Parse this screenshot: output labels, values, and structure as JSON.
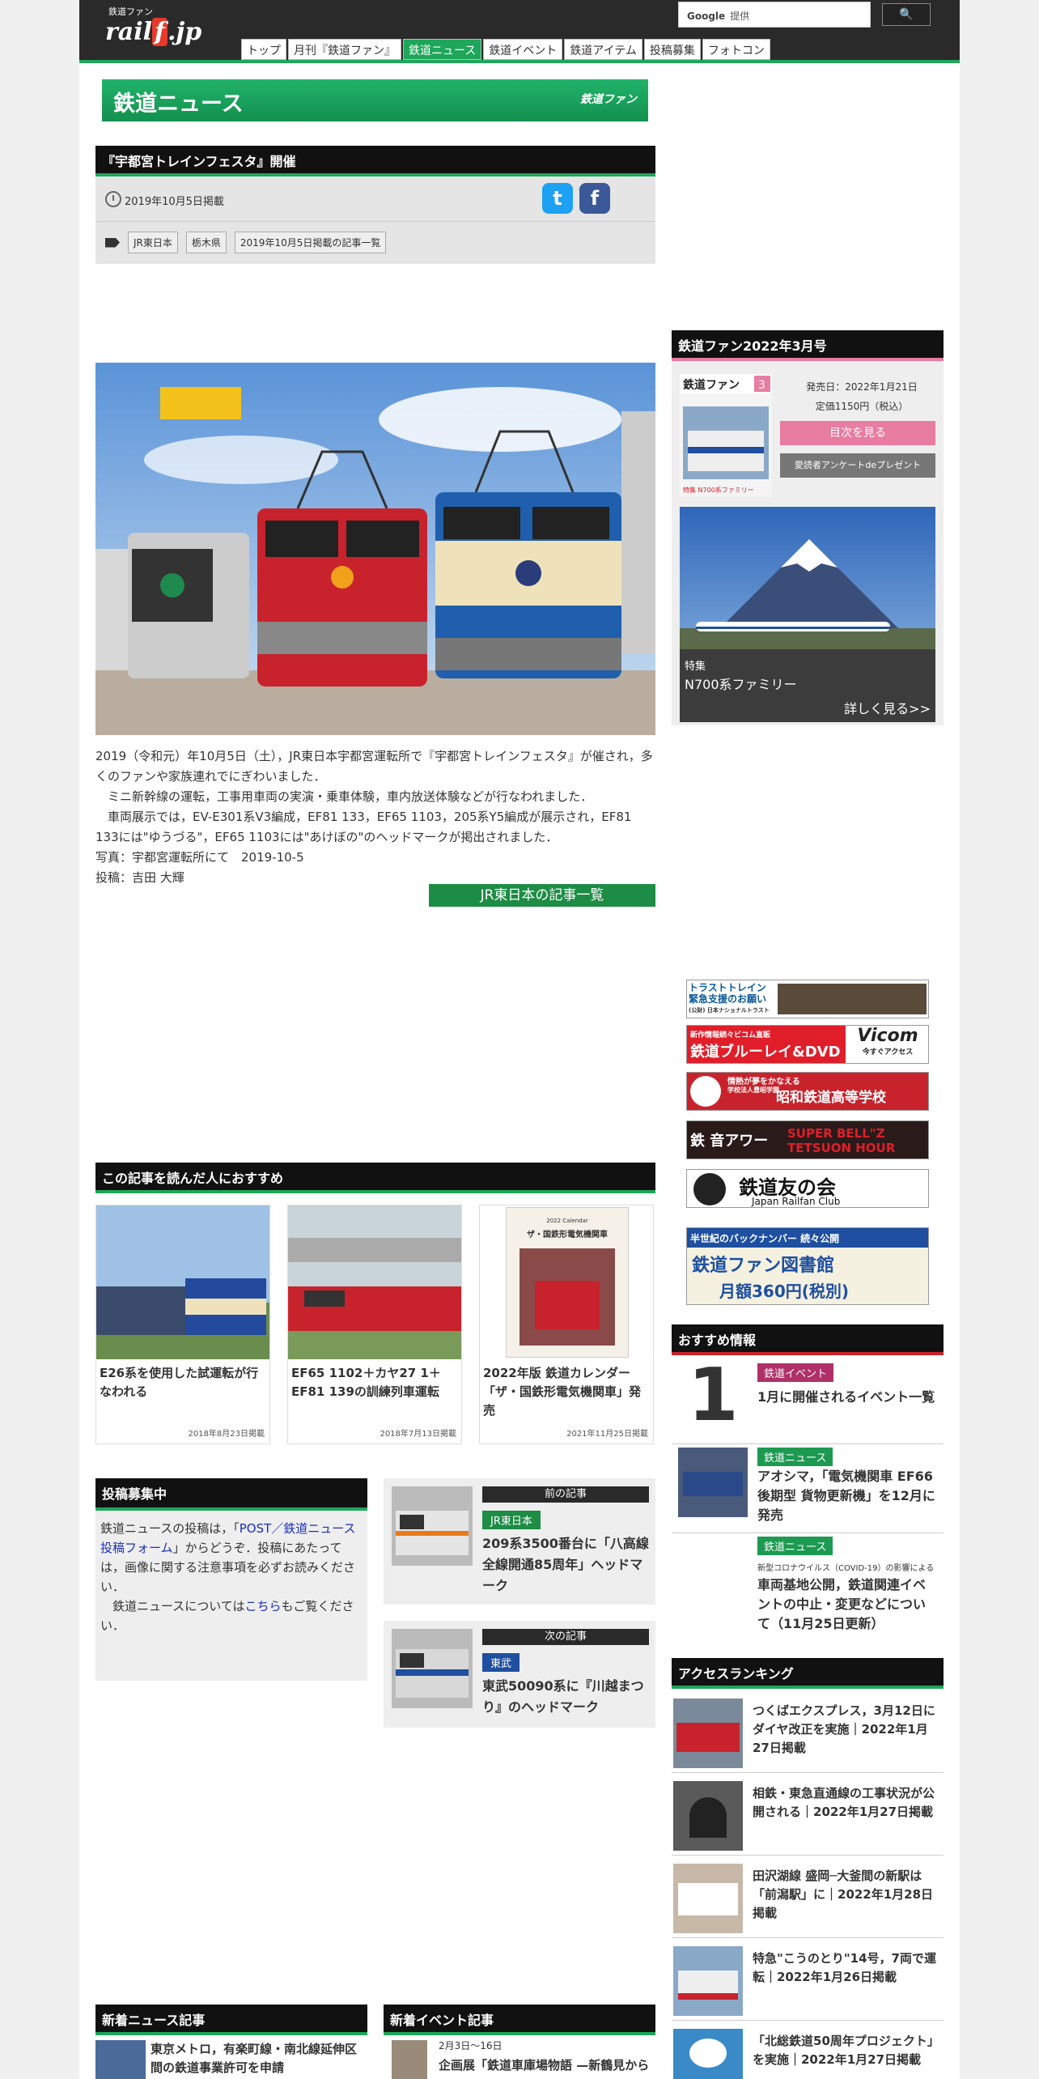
{
  "header": {
    "logo_small": "鉄道ファン",
    "logo_text": "railf.jp",
    "search_brand": "Google",
    "search_suffix": "提供",
    "search_btn": "🔍"
  },
  "nav": [
    "トップ",
    "月刊『鉄道ファン』",
    "鉄道ニュース",
    "鉄道イベント",
    "鉄道アイテム",
    "投稿募集",
    "フォトコン"
  ],
  "banner": {
    "title": "鉄道ニュース",
    "sub": "鉄道ファン"
  },
  "article": {
    "title": "『宇都宮トレインフェスタ』開催",
    "date": "2019年10月5日掲載",
    "tags": [
      "JR東日本",
      "栃木県",
      "2019年10月5日掲載の記事一覧"
    ],
    "body": [
      "2019（令和元）年10月5日（土），JR東日本宇都宮運転所で『宇都宮トレインフェスタ』が催され，多くのファンや家族連れでにぎわいました．",
      "　ミニ新幹線の運転，工事用車両の実演・乗車体験，車内放送体験などが行なわれました．",
      "　車両展示では，EV-E301系V3編成，EF81 133，EF65 1103，205系Y5編成が展示され，EF81 133には\"ゆうづる\"，EF65 1103には\"あけぼの\"のヘッドマークが掲出されました．",
      "写真：宇都宮運転所にて　2019-10-5",
      "投稿：吉田 大輝"
    ],
    "more_btn": "JR東日本の記事一覧"
  },
  "recommend": {
    "heading": "この記事を読んだ人におすすめ",
    "items": [
      {
        "caption": "E26系を使用した試運転が行なわれる",
        "date": "2018年8月23日掲載"
      },
      {
        "caption": "EF65 1102＋カヤ27 1＋EF81 139の訓練列車運転",
        "date": "2018年7月13日掲載"
      },
      {
        "caption": "2022年版 鉄道カレンダー「ザ・国鉄形電気機関車」発売",
        "date": "2021年11月25日掲載",
        "calendar_title": "2022 Calendar",
        "calendar_name": "ザ・国鉄形電気機関車"
      }
    ]
  },
  "post": {
    "heading": "投稿募集中",
    "text1": "鉄道ニュースの投稿は，「",
    "link1": "POST／鉄道ニュース投稿フォーム",
    "text2": "」からどうぞ．投稿にあたっては，画像に関する注意事項を必ずお読みください．",
    "text3": "　鉄道ニュースについては",
    "link2": "こちら",
    "text4": "もご覧ください．"
  },
  "prev": {
    "label": "前の記事",
    "category": "JR東日本",
    "title": "209系3500番台に「八高線全線開通85周年」ヘッドマーク"
  },
  "next": {
    "label": "次の記事",
    "category": "東武",
    "title": "東武50090系に『川越まつり』のヘッドマーク"
  },
  "magazine": {
    "heading": "鉄道ファン2022年3月号",
    "cover_title": "鉄道ファン",
    "cover_issue": "3",
    "cover_feature": "特集 N700系ファミリー",
    "release": "発売日：2022年1月21日",
    "price": "定価1150円（税込）",
    "btn_toc": "目次を見る",
    "btn_survey": "愛読者アンケートdeプレゼント",
    "feature_label": "特集",
    "feature_title": "N700系ファミリー",
    "feature_more": "詳しく見る>>"
  },
  "ads": [
    {
      "line1": "トラストトレイン",
      "line2": "緊急支援のお願い",
      "line3": "(公財) 日本ナショナルトラスト"
    },
    {
      "line1": "新作情報続々ビコム直販",
      "line2": "鉄道ブルーレイ&DVD",
      "brand": "Vicom",
      "sub": "今すぐアクセス"
    },
    {
      "line1": "情熱が夢をかなえる",
      "line2": "昭和鉄道高等学校",
      "sub": "学校法人豊昭学園"
    },
    {
      "line1": "鉄 音アワー",
      "line2": "SUPER BELL\"Z TETSUON HOUR"
    },
    {
      "line1": "鉄道友の会",
      "line2": "Japan Railfan Club"
    },
    {
      "line1": "半世紀のバックナンバー 続々公開",
      "line2": "鉄道ファン図書館",
      "line3": "月額360円(税別)"
    }
  ],
  "osusume": {
    "heading": "おすすめ情報",
    "items": [
      {
        "badge": "鉄道イベント",
        "badge_color": "#b0306a",
        "big": "1",
        "title": "1月に開催されるイベント一覧"
      },
      {
        "badge": "鉄道ニュース",
        "badge_color": "#1d9a52",
        "title": "アオシマ，「電気機関車 EF66 後期型 貨物更新機」を12月に発売"
      },
      {
        "badge": "鉄道ニュース",
        "badge_color": "#1d9a52",
        "pre": "新型コロナウイルス（COVID-19）の影響による",
        "title": "車両基地公開，鉄道関連イベントの中止・変更などについて（11月25日更新）"
      }
    ]
  },
  "ranking": {
    "heading": "アクセスランキング",
    "items": [
      "つくばエクスプレス，3月12日にダイヤ改正を実施｜2022年1月27日掲載",
      "相鉄・東急直通線の工事状況が公開される｜2022年1月27日掲載",
      "田沢湖線 盛岡─大釜間の新駅は「前潟駅」に｜2022年1月28日掲載",
      "特急\"こうのとり\"14号，7両で運転｜2022年1月26日掲載",
      "「北総鉄道50周年プロジェクト」を実施｜2022年1月27日掲載"
    ]
  },
  "news_new": {
    "heading": "新着ニュース記事",
    "item": "東京メトロ，有楽町線・南北線延伸区間の鉄道事業許可を申請"
  },
  "event_new": {
    "heading": "新着イベント記事",
    "date": "2月3日〜16日",
    "item": "企画展「鉄道車庫場物語 —新鶴見から"
  }
}
